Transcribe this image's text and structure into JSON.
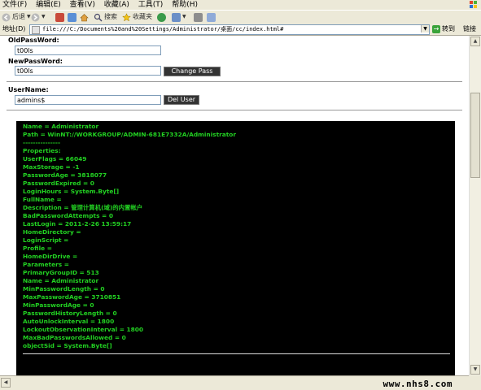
{
  "menu": {
    "items": [
      "文件(F)",
      "编辑(E)",
      "查看(V)",
      "收藏(A)",
      "工具(T)",
      "帮助(H)"
    ]
  },
  "toolbar": {
    "back_label": "后退",
    "search_label": "搜索",
    "favorites_label": "收藏夹"
  },
  "address": {
    "label": "地址(D)",
    "url": "file:///C:/Documents%20and%20Settings/Administrator/桌面/cc/index.html#",
    "go_label": "转到",
    "links_label": "链接"
  },
  "form": {
    "old_password_label": "OldPassWord:",
    "old_password_value": "t00ls",
    "new_password_label": "NewPassWord:",
    "new_password_value": "t00ls",
    "change_pass_button": "Change Pass",
    "username_label": "UserName:",
    "username_value": "admins$",
    "del_user_button": "Del User"
  },
  "console": {
    "lines": [
      "Name = Administrator",
      "Path = WinNT://WORKGROUP/ADMIN-681E7332A/Administrator",
      "---------------",
      "Properties:",
      "UserFlags = 66049",
      "MaxStorage = -1",
      "PasswordAge = 3818077",
      "PasswordExpired = 0",
      "LoginHours = System.Byte[]",
      "FullName =",
      "Description = 管理计算机(域)的内置帐户",
      "BadPasswordAttempts = 0",
      "LastLogin = 2011-2-26 13:59:17",
      "HomeDirectory =",
      "LoginScript =",
      "Profile =",
      "HomeDirDrive =",
      "Parameters =",
      "PrimaryGroupID = 513",
      "Name = Administrator",
      "MinPasswordLength = 0",
      "MaxPasswordAge = 3710851",
      "MinPasswordAge = 0",
      "PasswordHistoryLength = 0",
      "AutoUnlockInterval = 1800",
      "LockoutObservationInterval = 1800",
      "MaxBadPasswordsAllowed = 0",
      "objectSid = System.Byte[]"
    ]
  },
  "watermark": "www.nhs8.com",
  "colors": {
    "console_bg": "#000000",
    "console_text": "#22d122",
    "chrome_bg": "#ece9d8"
  }
}
